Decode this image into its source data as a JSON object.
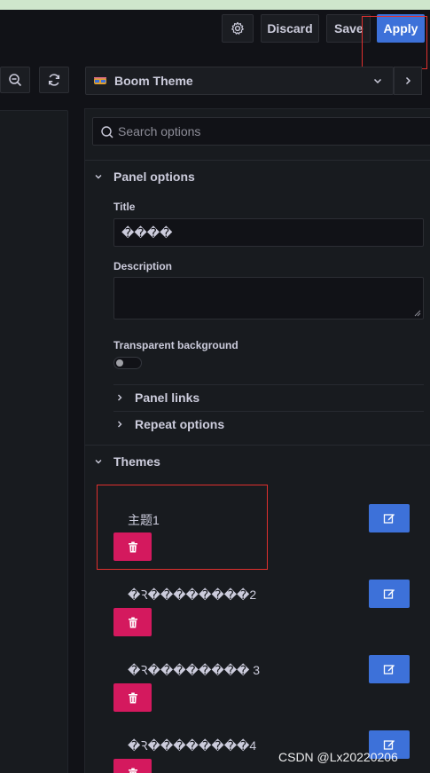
{
  "toolbar": {
    "discard_label": "Discard",
    "save_label": "Save",
    "apply_label": "Apply"
  },
  "visualization": {
    "name": "Boom Theme"
  },
  "search": {
    "placeholder": "Search options"
  },
  "panel_options": {
    "header": "Panel options",
    "title_label": "Title",
    "title_value": "����",
    "description_label": "Description",
    "description_value": "",
    "transparent_label": "Transparent background",
    "transparent_on": false,
    "panel_links": "Panel links",
    "repeat_options": "Repeat options"
  },
  "themes": {
    "header": "Themes",
    "items": [
      {
        "name": "主题1"
      },
      {
        "name": "�Ꝛ��������2"
      },
      {
        "name": "�Ꝛ�������� 3"
      },
      {
        "name": "�Ꝛ��������4"
      }
    ]
  },
  "watermark": "CSDN @Lx20220206",
  "colors": {
    "apply": "#3d71d9",
    "edit": "#3d71d9",
    "delete": "#d4195e",
    "highlight": "#e0302e"
  },
  "icons": [
    "gear-icon",
    "zoom-out-icon",
    "refresh-icon",
    "theme-icon",
    "chevron-down-icon",
    "chevron-right-icon",
    "search-icon",
    "edit-icon",
    "trash-icon",
    "resize-grip-icon"
  ]
}
